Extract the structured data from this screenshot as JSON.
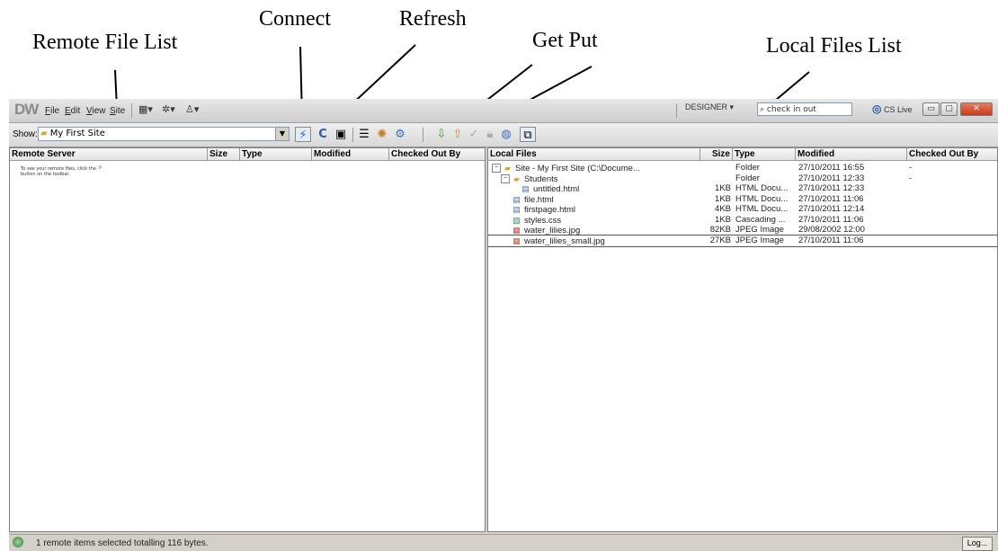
{
  "annotations": {
    "connect": "Connect",
    "refresh": "Refresh",
    "remote_file_list": "Remote File List",
    "get_put": "Get  Put",
    "local_files_list": "Local Files List"
  },
  "menubar": {
    "logo": "DW",
    "items": [
      "File",
      "Edit",
      "View",
      "Site"
    ],
    "workspace": "DESIGNER ▾",
    "search_value": "check in out",
    "cs_live": "CS Live"
  },
  "toolbar": {
    "show_label": "Show:",
    "site_name": "My First Site"
  },
  "remote": {
    "columns": [
      "Remote Server",
      "Size",
      "Type",
      "Modified",
      "Checked Out By"
    ],
    "note": "To see your remote files, click the",
    "note2": "button on the toolbar."
  },
  "local": {
    "columns": [
      "Local Files",
      "Size",
      "Type",
      "Modified",
      "Checked Out By"
    ],
    "rows": [
      {
        "name": "Site - My First Site (C:\\Docume...",
        "size": "",
        "type": "Folder",
        "modified": "27/10/2011 16:55",
        "checked": "-",
        "icon": "folder-icon",
        "level": 0
      },
      {
        "name": "Students",
        "size": "",
        "type": "Folder",
        "modified": "27/10/2011 12:33",
        "checked": "-",
        "icon": "folder-icon",
        "level": 1
      },
      {
        "name": "untitled.html",
        "size": "1KB",
        "type": "HTML Docu...",
        "modified": "27/10/2011 12:33",
        "checked": "",
        "icon": "html-file-icon",
        "level": 2
      },
      {
        "name": "file.html",
        "size": "1KB",
        "type": "HTML Docu...",
        "modified": "27/10/2011 11:06",
        "checked": "",
        "icon": "html-file-icon",
        "level": 1
      },
      {
        "name": "firstpage.html",
        "size": "4KB",
        "type": "HTML Docu...",
        "modified": "27/10/2011 12:14",
        "checked": "",
        "icon": "html-file-icon",
        "level": 1
      },
      {
        "name": "styles.css",
        "size": "1KB",
        "type": "Cascading ...",
        "modified": "27/10/2011 11:06",
        "checked": "",
        "icon": "css-file-icon",
        "level": 1
      },
      {
        "name": "water_lilies.jpg",
        "size": "82KB",
        "type": "JPEG Image",
        "modified": "29/08/2002 12:00",
        "checked": "",
        "icon": "image-file-icon",
        "level": 1
      },
      {
        "name": "water_lilies_small.jpg",
        "size": "27KB",
        "type": "JPEG Image",
        "modified": "27/10/2011 11:06",
        "checked": "",
        "icon": "image-file-icon",
        "level": 1
      }
    ]
  },
  "status": {
    "text": "1 remote items selected totalling 116 bytes.",
    "log": "Log..."
  },
  "colors": {
    "accent": "#2a5da8",
    "folder": "#d6a62a",
    "get": "#2e9a2e",
    "put": "#d08a1a"
  }
}
